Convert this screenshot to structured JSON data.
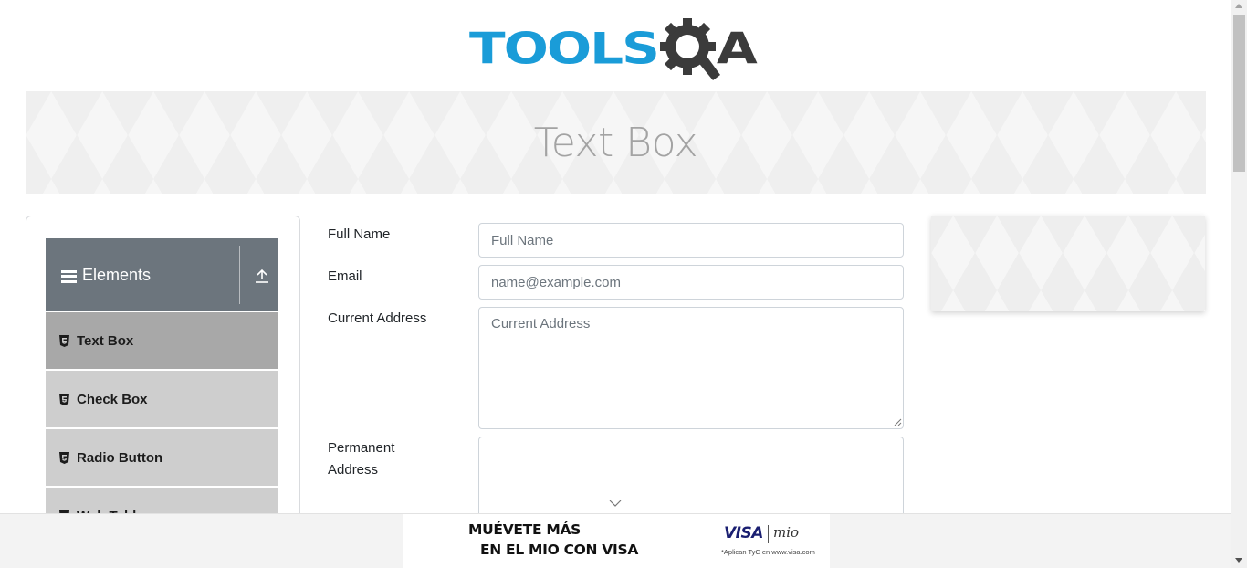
{
  "header": {
    "logo_text_primary": "TOOLS",
    "logo_text_secondary": "A",
    "logo_colors": {
      "tools": "#1a9cd8",
      "qa": "#3b3b3b"
    }
  },
  "banner": {
    "title": "Text Box"
  },
  "sidebar": {
    "group": {
      "label": "Elements",
      "icon": "hamburger-icon",
      "action_icon": "collapse-up-icon"
    },
    "items": [
      {
        "label": "Text Box",
        "icon": "html5-icon",
        "active": true
      },
      {
        "label": "Check Box",
        "icon": "html5-icon",
        "active": false
      },
      {
        "label": "Radio Button",
        "icon": "html5-icon",
        "active": false
      },
      {
        "label": "Web Tables",
        "icon": "html5-icon",
        "active": false
      }
    ]
  },
  "form": {
    "full_name": {
      "label": "Full Name",
      "placeholder": "Full Name",
      "value": ""
    },
    "email": {
      "label": "Email",
      "placeholder": "name@example.com",
      "value": ""
    },
    "current_address": {
      "label": "Current Address",
      "placeholder": "Current Address",
      "value": ""
    },
    "permanent_address": {
      "label": "Permanent Address",
      "placeholder": "",
      "value": ""
    }
  },
  "bottom_ad": {
    "line1": "MUÉVETE MÁS",
    "line2": "EN EL MIO CON VISA",
    "brand": "VISA",
    "partner": "mio",
    "terms": "*Aplican TyC en www.visa.com"
  },
  "colors": {
    "nav_header_bg": "#6c757d",
    "nav_item_bg": "#cecece",
    "nav_item_active_bg": "#a8a8a8",
    "banner_title": "#a3a3a3"
  }
}
